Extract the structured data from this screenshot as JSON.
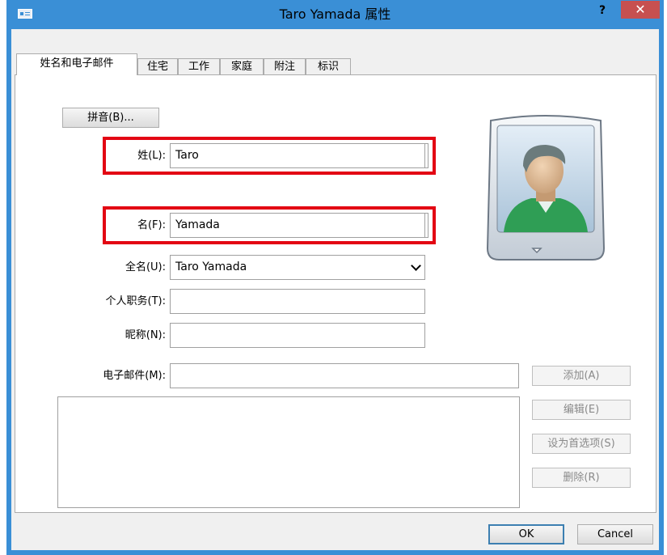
{
  "window": {
    "title": "Taro Yamada 属性",
    "help_label": "?",
    "close_label": "✕"
  },
  "tabs": [
    {
      "label": "姓名和电子邮件",
      "active": true
    },
    {
      "label": "住宅",
      "active": false
    },
    {
      "label": "工作",
      "active": false
    },
    {
      "label": "家庭",
      "active": false
    },
    {
      "label": "附注",
      "active": false
    },
    {
      "label": "标识",
      "active": false
    }
  ],
  "form": {
    "pinyin_button": "拼音(B)...",
    "surname_label": "姓(L):",
    "surname_value": "Taro",
    "given_label": "名(F):",
    "given_value": "Yamada",
    "fullname_label": "全名(U):",
    "fullname_value": "Taro Yamada",
    "title_label": "个人职务(T):",
    "title_value": "",
    "nickname_label": "昵称(N):",
    "nickname_value": "",
    "email_label": "电子邮件(M):",
    "email_value": ""
  },
  "email_buttons": {
    "add": "添加(A)",
    "edit": "编辑(E)",
    "set_preferred": "设为首选项(S)",
    "delete": "删除(R)"
  },
  "footer": {
    "ok": "OK",
    "cancel": "Cancel"
  },
  "colors": {
    "titlebar": "#3a8fd6",
    "close": "#c75050",
    "highlight": "#e30613"
  }
}
